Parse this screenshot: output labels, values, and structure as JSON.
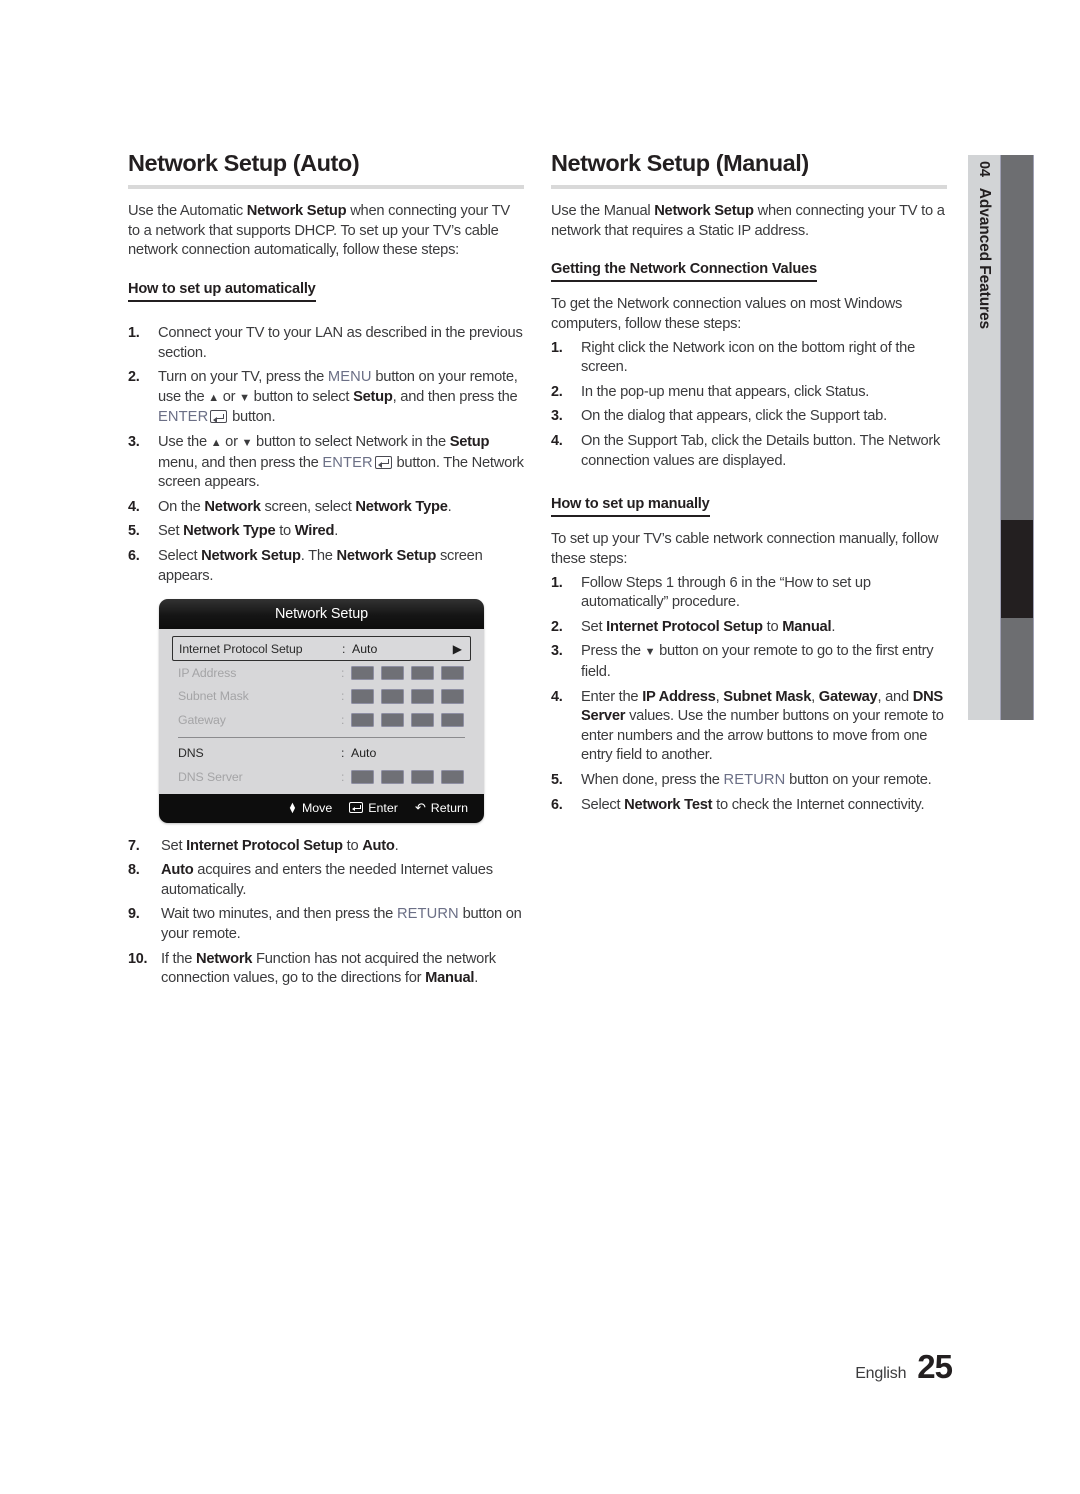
{
  "page": {
    "language_label": "English",
    "page_number": "25"
  },
  "chapter_tab": {
    "number": "04",
    "name": "Advanced Features"
  },
  "left_column": {
    "title": "Network Setup (Auto)",
    "intro": "Use the Automatic Network Setup when connecting your TV to a network that supports DHCP. To set up your TV’s cable network connection automatically, follow these steps:",
    "subheading": "How to set up automatically",
    "steps": [
      {
        "num": "1.",
        "text": "Connect your TV to your LAN as described in the previous section."
      },
      {
        "num": "2.",
        "text": "Turn on your TV, press the MENU button on your remote, use the ▲ or ▼ button to select Setup, and then press the ENTER button."
      },
      {
        "num": "3.",
        "text": "Use the ▲ or ▼ button to select Network in the Setup menu, and then press the ENTER button. The Network screen appears."
      },
      {
        "num": "4.",
        "text": "On the Network screen, select Network Type."
      },
      {
        "num": "5.",
        "text": "Set Network Type to Wired."
      },
      {
        "num": "6.",
        "text": "Select Network Setup. The Network Setup screen appears."
      }
    ],
    "steps_after": [
      {
        "num": "7.",
        "text": "Set Internet Protocol Setup to Auto."
      },
      {
        "num": "8.",
        "text": "Auto acquires and enters the needed Internet values automatically."
      },
      {
        "num": "9.",
        "text": "Wait two minutes, and then press the RETURN button on your remote."
      },
      {
        "num": "10.",
        "text": "If the Network Function has not acquired the network connection values, go to the directions for Manual."
      }
    ]
  },
  "osd": {
    "title": "Network Setup",
    "rows": [
      {
        "label": "Internet Protocol Setup",
        "value": "Auto",
        "type": "select",
        "selected": true,
        "dim": false
      },
      {
        "label": "IP Address",
        "value": "",
        "type": "boxes",
        "selected": false,
        "dim": true
      },
      {
        "label": "Subnet Mask",
        "value": "",
        "type": "boxes",
        "selected": false,
        "dim": true
      },
      {
        "label": "Gateway",
        "value": "",
        "type": "boxes",
        "selected": false,
        "dim": true
      },
      {
        "label": "DNS",
        "value": "Auto",
        "type": "text",
        "selected": false,
        "dim": false
      },
      {
        "label": "DNS Server",
        "value": "",
        "type": "boxes",
        "selected": false,
        "dim": true
      }
    ],
    "footer": {
      "move": "Move",
      "enter": "Enter",
      "return": "Return"
    }
  },
  "right_column": {
    "title": "Network Setup (Manual)",
    "intro": "Use the Manual Network Setup when connecting your TV to a network that requires a Static IP address.",
    "subheading_1": "Getting the Network Connection Values",
    "lead_1": "To get the Network connection values on most Windows computers, follow these steps:",
    "steps_1": [
      {
        "num": "1.",
        "text": "Right click the Network icon on the bottom right of the screen."
      },
      {
        "num": "2.",
        "text": "In the pop-up menu that appears, click Status."
      },
      {
        "num": "3.",
        "text": "On the dialog that appears, click the Support tab."
      },
      {
        "num": "4.",
        "text": "On the Support Tab, click the Details button. The Network connection values are displayed."
      }
    ],
    "subheading_2": "How to set up manually",
    "lead_2": "To set up your TV’s cable network connection manually, follow these steps:",
    "steps_2": [
      {
        "num": "1.",
        "text": "Follow Steps 1 through 6 in the “How to set up automatically” procedure."
      },
      {
        "num": "2.",
        "text": "Set Internet Protocol Setup to Manual."
      },
      {
        "num": "3.",
        "text": "Press the ▼ button on your remote to go to the first entry field."
      },
      {
        "num": "4.",
        "text": "Enter the IP Address, Subnet Mask, Gateway, and DNS Server values. Use the number buttons on your remote to enter numbers and the arrow buttons to move from one entry field to another."
      },
      {
        "num": "5.",
        "text": "When done, press the RETURN button on your remote."
      },
      {
        "num": "6.",
        "text": "Select Network Test to check the Internet connectivity."
      }
    ]
  },
  "colors": {
    "key_text": "#6b6f86",
    "tab_bar": "#6d6e71",
    "tab_bg": "#d2d4d6",
    "rule": "#d9d9d9"
  }
}
